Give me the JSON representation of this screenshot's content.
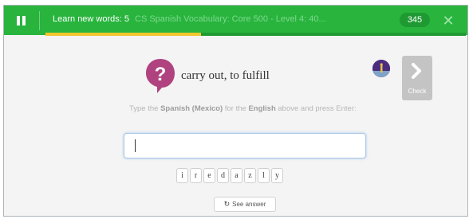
{
  "header": {
    "title": "Learn new words: 5",
    "subtitle": "CS Spanish Vocabulary: Core 500 - Level 4: 40...",
    "score": "345",
    "progress_fraction": 0.37,
    "pause_icon": "pause-icon",
    "close_icon": "close-icon",
    "close_symbol": "✕"
  },
  "prompt": {
    "icon": "question-icon",
    "icon_symbol": "?",
    "text": "carry out, to fulfill"
  },
  "instructions": {
    "part1": "Type the ",
    "lang_target": "Spanish (Mexico)",
    "part2": " for the ",
    "lang_source": "English",
    "part3": " above and press Enter:"
  },
  "answer": {
    "value": "",
    "placeholder": ""
  },
  "letter_keys": [
    "i",
    "r",
    "e",
    "d",
    "a",
    "z",
    "l",
    "y"
  ],
  "check_button": {
    "label": "Check",
    "icon": "chevron-right-icon"
  },
  "see_answer": {
    "label": "See answer",
    "icon": "refresh-icon",
    "icon_symbol": "↻"
  },
  "colors": {
    "topbar": "#28b43d",
    "progress": "#f2c52e",
    "question_bubble": "#b0437f",
    "check_button": "#c4c4c4"
  }
}
